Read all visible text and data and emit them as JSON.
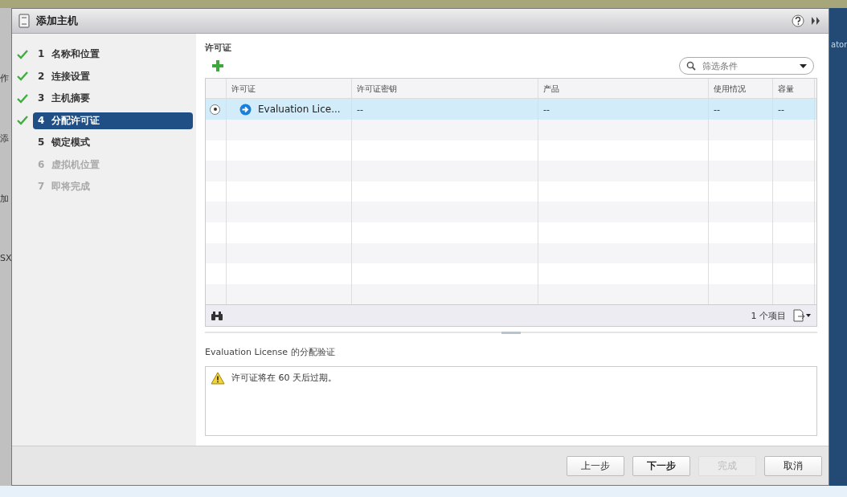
{
  "background": {
    "left_fragments": [
      "作",
      "添",
      "加",
      "SX"
    ],
    "right_fragment": "ator"
  },
  "window": {
    "title": "添加主机"
  },
  "steps": [
    {
      "number": "1",
      "label": "名称和位置",
      "done": true,
      "selected": false,
      "disabled": false
    },
    {
      "number": "2",
      "label": "连接设置",
      "done": true,
      "selected": false,
      "disabled": false
    },
    {
      "number": "3",
      "label": "主机摘要",
      "done": true,
      "selected": false,
      "disabled": false
    },
    {
      "number": "4",
      "label": "分配许可证",
      "done": true,
      "selected": true,
      "disabled": false
    },
    {
      "number": "5",
      "label": "锁定模式",
      "done": false,
      "selected": false,
      "disabled": false
    },
    {
      "number": "6",
      "label": "虚拟机位置",
      "done": false,
      "selected": false,
      "disabled": true
    },
    {
      "number": "7",
      "label": "即将完成",
      "done": false,
      "selected": false,
      "disabled": true
    }
  ],
  "section_title": "许可证",
  "filter": {
    "placeholder": "筛选条件"
  },
  "table": {
    "columns": [
      "许可证",
      "许可证密钥",
      "产品",
      "使用情况",
      "容量"
    ],
    "rows": [
      {
        "selected": true,
        "cells": [
          "Evaluation Lice...",
          "--",
          "--",
          "--",
          "--"
        ]
      }
    ],
    "footer_count": "1 个项目"
  },
  "validation": {
    "title": "Evaluation License 的分配验证",
    "message": "许可证将在 60 天后过期。"
  },
  "buttons": [
    {
      "label": "上一步",
      "disabled": false,
      "primary": false
    },
    {
      "label": "下一步",
      "disabled": false,
      "primary": true
    },
    {
      "label": "完成",
      "disabled": true,
      "primary": false
    },
    {
      "label": "取消",
      "disabled": false,
      "primary": false
    }
  ]
}
